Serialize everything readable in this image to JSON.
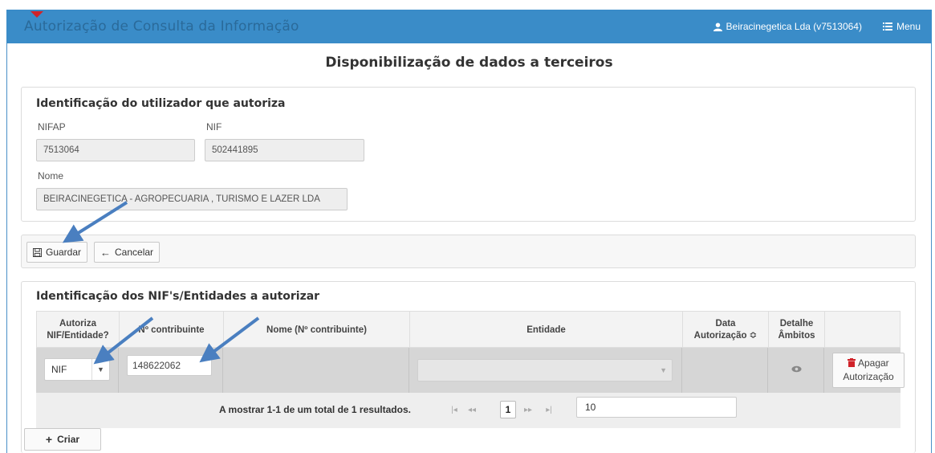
{
  "header": {
    "app_title": "Autorização de Consulta da Informação",
    "user_label": "Beiracinegetica Lda (v7513064)",
    "menu_label": "Menu"
  },
  "page_title": "Disponibilização de dados a terceiros",
  "user_section": {
    "title": "Identificação do utilizador que autoriza",
    "nifap_label": "NIFAP",
    "nifap_value": "7513064",
    "nif_label": "NIF",
    "nif_value": "502441895",
    "nome_label": "Nome",
    "nome_value": "BEIRACINEGETICA - AGROPECUARIA , TURISMO E LAZER LDA"
  },
  "toolbar": {
    "save_label": "Guardar",
    "cancel_label": "Cancelar"
  },
  "entities_section": {
    "title": "Identificação dos NIF's/Entidades a autorizar",
    "columns": {
      "autoriza": "Autoriza NIF/Entidade?",
      "contribuinte": "Nº contribuinte",
      "nome": "Nome (Nº contribuinte)",
      "entidade": "Entidade",
      "data": "Data Autorização ≎",
      "detalhe": "Detalhe Âmbitos"
    },
    "rows": [
      {
        "autoriza": "NIF",
        "contribuinte": "148622062",
        "nome": "",
        "entidade": "",
        "delete_label": "Apagar Autorização"
      }
    ],
    "pager": {
      "summary": "A mostrar 1-1 de um total de 1 resultados.",
      "current_page": "1",
      "rows_per_page": "10"
    },
    "create_label": "Criar"
  },
  "colors": {
    "topbar": "#3a8cc8",
    "arrow": "#4a7fc0",
    "delete_icon": "#d0232a"
  }
}
